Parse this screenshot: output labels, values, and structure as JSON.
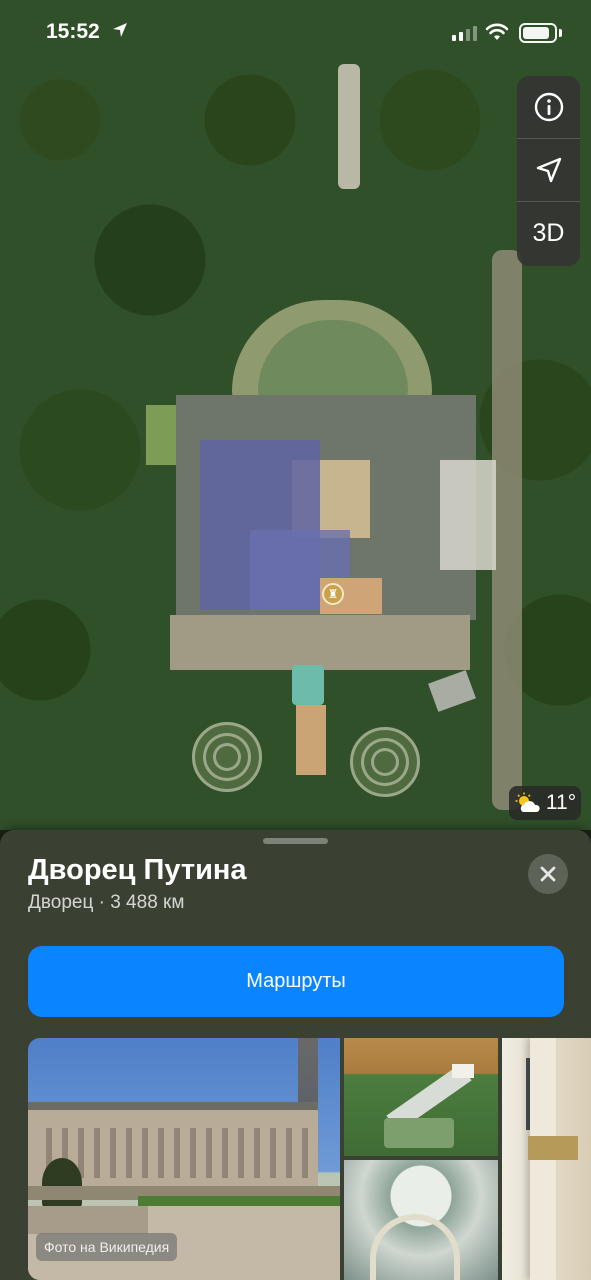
{
  "status_bar": {
    "time": "15:52"
  },
  "map_controls": {
    "three_d_label": "3D"
  },
  "weather": {
    "temperature": "11°"
  },
  "place": {
    "title": "Дворец Путина",
    "subtitle": "Дворец · 3 488 км",
    "route_button": "Маршруты",
    "photo_credit": "Фото на Википедия"
  },
  "colors": {
    "accent": "#0a84ff",
    "sheet_bg": "#3a4133"
  }
}
